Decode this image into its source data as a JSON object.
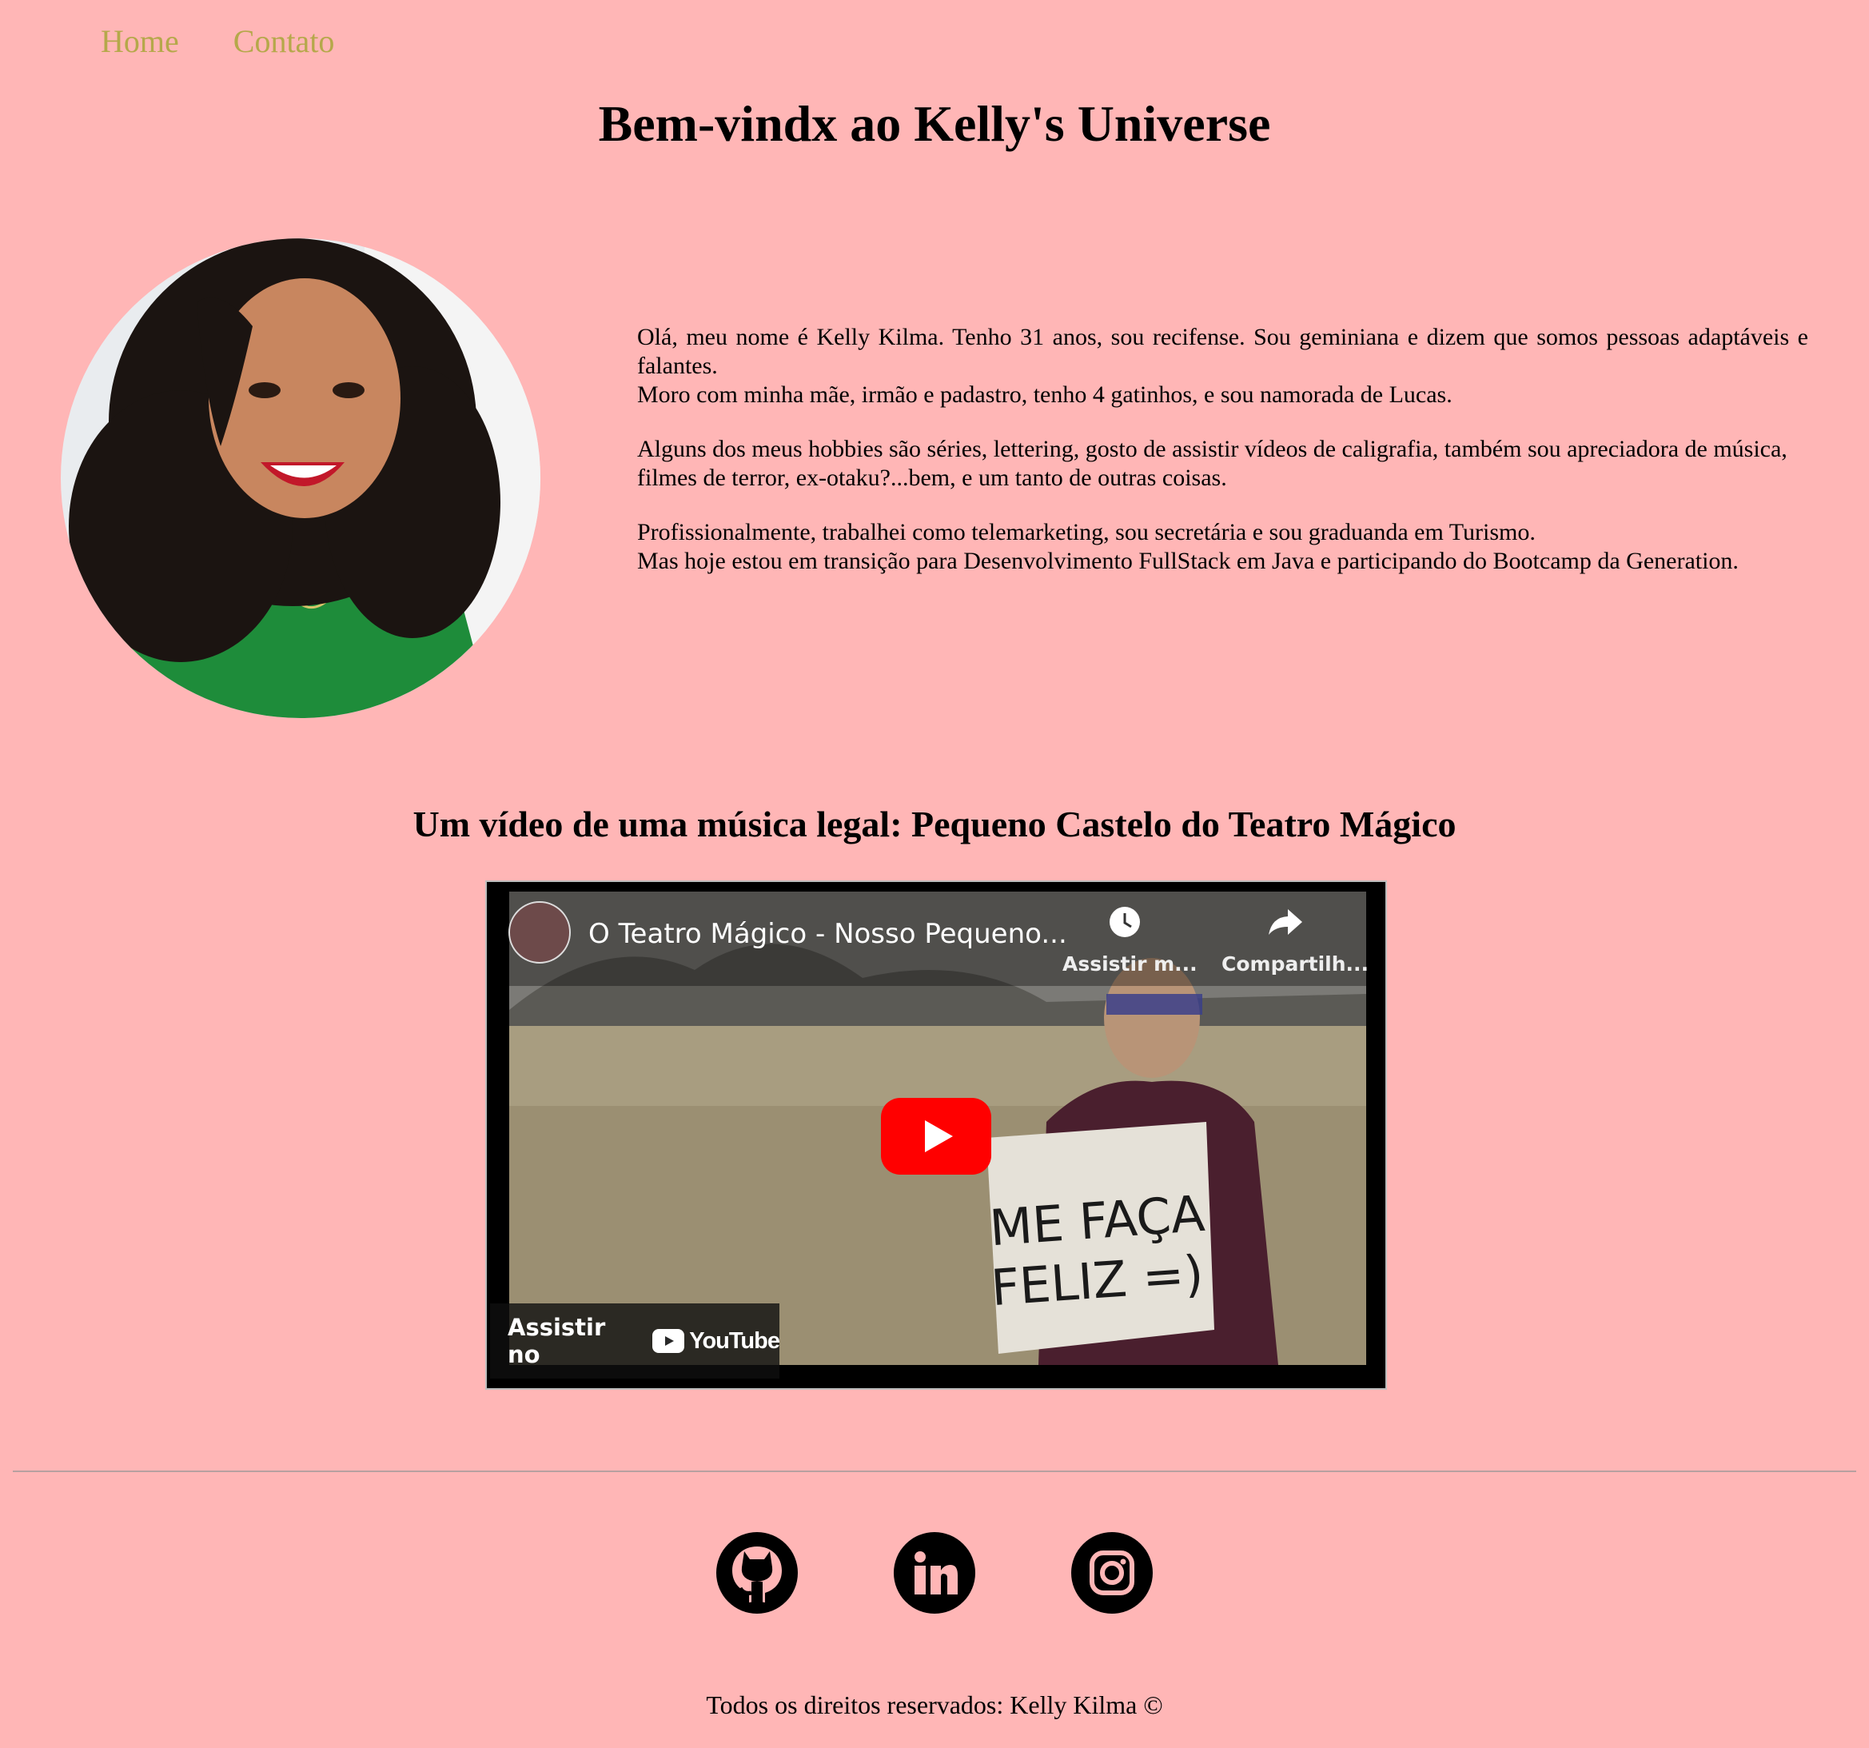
{
  "nav": {
    "home": "Home",
    "contact": "Contato"
  },
  "title": "Bem-vindx ao Kelly's Universe",
  "about": {
    "p1_line1": "Olá, meu nome é Kelly Kilma. Tenho 31 anos, sou recifense. Sou geminiana e dizem que somos pessoas adaptáveis e falantes.",
    "p1_line2": "Moro com minha mãe, irmão e padastro, tenho 4 gatinhos, e sou namorada de Lucas.",
    "p2_line1": "Alguns dos meus hobbies são séries, lettering, gosto de assistir vídeos de caligrafia, também sou apreciadora de música,",
    "p2_line2": "filmes de terror, ex-otaku?...bem, e um tanto de outras coisas.",
    "p3_line1": "Profissionalmente, trabalhei como telemarketing, sou secretária e sou graduanda em Turismo.",
    "p3_line2": "Mas hoje estou em transição para Desenvolvimento FullStack em Java e participando do Bootcamp da Generation."
  },
  "video": {
    "heading": "Um vídeo de uma música legal: Pequeno Castelo do Teatro Mágico",
    "title": "O Teatro Mágico - Nosso Pequeno...",
    "watch_later": "Assistir m...",
    "share": "Compartilh...",
    "watch_on": "Assistir no",
    "youtube": "YouTube",
    "sign_line1": "ME FAÇA",
    "sign_line2": "FELIZ =)"
  },
  "social": {
    "github_icon": "github-icon",
    "linkedin_icon": "linkedin-icon",
    "instagram_icon": "instagram-icon"
  },
  "footer": "Todos os direitos reservados: Kelly Kilma ©"
}
